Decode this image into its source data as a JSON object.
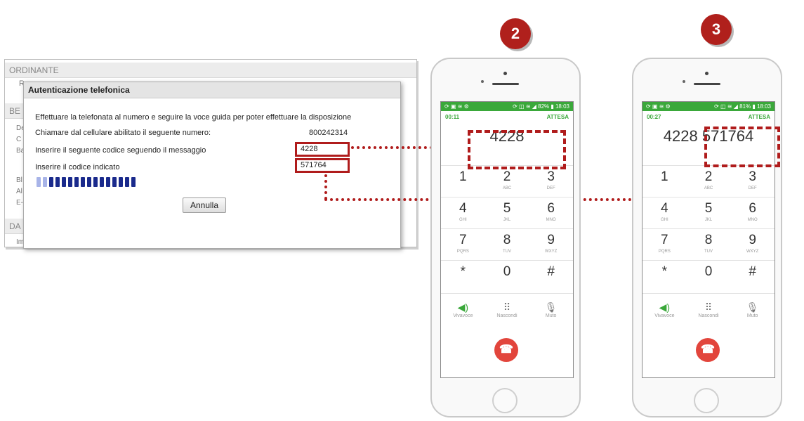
{
  "background_form": {
    "section_ordinante": "ORDINANTE",
    "section_be": "BE",
    "section_da": "DA",
    "fragments": [
      "Ra",
      "De",
      "C",
      "Ba",
      "Bl",
      "Al",
      "E-",
      "Im"
    ]
  },
  "dialog": {
    "title": "Autenticazione telefonica",
    "intro": "Effettuare la telefonata al numero e seguire la voce guida per poter effettuare la disposizione",
    "row1_label": "Chiamare dal cellulare abilitato il seguente numero:",
    "row1_value": "800242314",
    "row2_label": "Inserire il seguente codice seguendo il messaggio",
    "row2_value": "4228",
    "row3_label": "Inserire il codice indicato",
    "row3_value": "571764",
    "progress_filled_fraction": 0.88,
    "cancel_label": "Annulla"
  },
  "steps": {
    "step2": "2",
    "step3": "3"
  },
  "phone2": {
    "status_left": "⟳ ▣ ≋ ⚙",
    "status_right": "⟳ ◫ ≋ ◢ 82% ▮ 18:03",
    "timer": "00:11",
    "state": "ATTESA",
    "dialed": "4228"
  },
  "phone3": {
    "status_left": "⟳ ▣ ≋ ⚙",
    "status_right": "⟳ ◫ ≋ ◢ 81% ▮ 18:03",
    "timer": "00:27",
    "state": "ATTESA",
    "dialed": "4228 571764"
  },
  "keypad": {
    "k1": "1",
    "k1s": "",
    "k2": "2",
    "k2s": "ABC",
    "k3": "3",
    "k3s": "DEF",
    "k4": "4",
    "k4s": "GHI",
    "k5": "5",
    "k5s": "JKL",
    "k6": "6",
    "k6s": "MNO",
    "k7": "7",
    "k7s": "PQRS",
    "k8": "8",
    "k8s": "TUV",
    "k9": "9",
    "k9s": "WXYZ",
    "kstar": "*",
    "k0": "0",
    "khash": "#"
  },
  "actions": {
    "speaker": "Vivavoce",
    "hide": "Nascondi",
    "mute": "Muto"
  },
  "icons": {
    "speaker_icon": "◀)",
    "keypad_icon": "⠿",
    "mute_icon": "🎙",
    "hangup_icon": "☎"
  },
  "colors": {
    "accent_red": "#b01c1c",
    "android_green": "#3aa83a",
    "hangup_red": "#e2453c",
    "progress_blue": "#1a2a8c"
  }
}
